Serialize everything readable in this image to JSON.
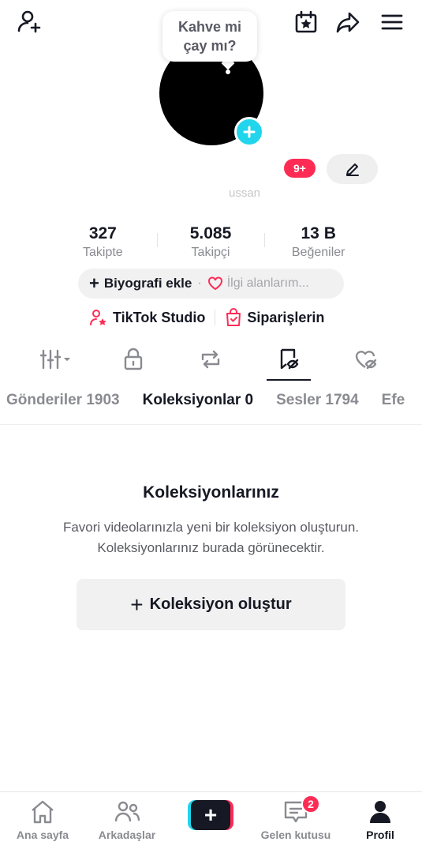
{
  "header": {
    "icons": [
      "add-user-icon",
      "calendar-star-icon",
      "share-icon",
      "menu-icon"
    ]
  },
  "profile": {
    "bubble_text": "Kahve mi\nçay mı?",
    "username_partial": "",
    "handle_partial": "ussan",
    "notifications_badge": "9+"
  },
  "stats": [
    {
      "value": "327",
      "label": "Takipte"
    },
    {
      "value": "5.085",
      "label": "Takipçi"
    },
    {
      "value": "13 B",
      "label": "Beğeniler"
    }
  ],
  "bio": {
    "add_bio_label": "Biyografi ekle",
    "separator": "·",
    "interests_label": "İlgi alanlarım..."
  },
  "tools": {
    "studio_label": "TikTok Studio",
    "orders_label": "Siparişlerin"
  },
  "sub_tabs": [
    {
      "label": "Gönderiler 1903",
      "active": false
    },
    {
      "label": "Koleksiyonlar 0",
      "active": true
    },
    {
      "label": "Sesler 1794",
      "active": false
    },
    {
      "label": "Efe",
      "active": false
    }
  ],
  "empty_state": {
    "title": "Koleksiyonlarınız",
    "description": "Favori videolarınızla yeni bir koleksiyon oluşturun. Koleksiyonlarınız burada görünecektir.",
    "create_label": "Koleksiyon oluştur"
  },
  "bottom_nav": {
    "home_label": "Ana sayfa",
    "friends_label": "Arkadaşlar",
    "inbox_label": "Gelen kutusu",
    "inbox_badge": "2",
    "profile_label": "Profil"
  },
  "colors": {
    "accent_pink": "#fe2c55",
    "accent_cyan": "#20d5ec",
    "text_primary": "#161823",
    "text_secondary": "#8a8b91"
  }
}
